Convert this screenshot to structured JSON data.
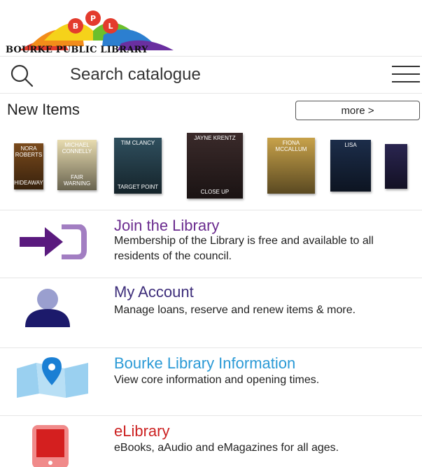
{
  "logo": {
    "name": "BOURKE PUBLIC LIBRARY",
    "letters": [
      "B",
      "P",
      "L"
    ]
  },
  "search": {
    "placeholder": "Search catalogue"
  },
  "new_items": {
    "title": "New Items",
    "more_label": "more >",
    "books": [
      {
        "author": "NORA ROBERTS",
        "title": "HIDEAWAY",
        "color": "#7a4a1c"
      },
      {
        "author": "MICHAEL CONNELLY",
        "title": "FAIR WARNING",
        "color": "#e8dcb0"
      },
      {
        "author": "TIM CLANCY",
        "title": "TARGET POINT",
        "color": "#2f4f5e"
      },
      {
        "author": "JAYNE KRENTZ",
        "title": "CLOSE UP",
        "color": "#3a2a2a"
      },
      {
        "author": "FIONA MCCALLUM",
        "title": "",
        "color": "#c8a24a"
      },
      {
        "author": "LISA",
        "title": "",
        "color": "#1c2d4a"
      },
      {
        "author": "",
        "title": "",
        "color": "#2a2550"
      }
    ]
  },
  "menu": [
    {
      "title": "Join the Library",
      "desc": "Membership of the Library is free and available to all residents of the council.",
      "color": "#6b2c8f"
    },
    {
      "title": "My Account",
      "desc": "Manage loans, reserve and renew items & more.",
      "color": "#3d2d7a"
    },
    {
      "title": "Bourke Library Information",
      "desc": "View core information and opening times.",
      "color": "#2b9ad6"
    },
    {
      "title": "eLibrary",
      "desc": "eBooks, aAudio and eMagazines for all ages.",
      "color": "#cc2222"
    }
  ]
}
